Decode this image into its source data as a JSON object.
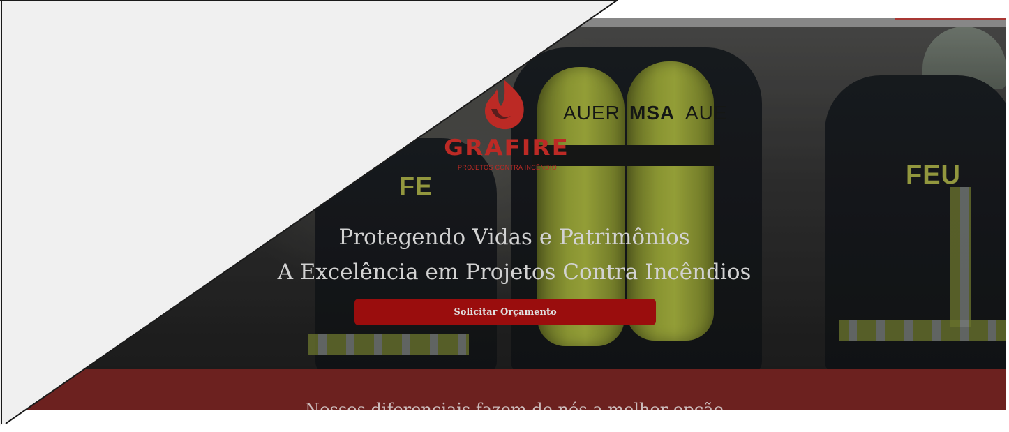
{
  "brand": {
    "name": "GRAFIRE",
    "tagline": "PROJETOS CONTRA INCÊNDIO",
    "color": "#d6302b"
  },
  "hero": {
    "headline_line1": "Protegendo Vidas e Patrimônios",
    "headline_line2": "A Excelência em Projetos Contra Incêndios",
    "tank_text_left": "AUER",
    "tank_text_mid": "MSA",
    "tank_text_right": "AUE",
    "jacket_text_left": "FE",
    "jacket_text_right": "FEU"
  },
  "cta": {
    "label": "Solicitar Orçamento",
    "color": "#b00f0f"
  },
  "band": {
    "text": "Nossos diferenciais fazem de nós a melhor opção",
    "color": "#7c2624"
  },
  "icons": {
    "logo": "flame-icon"
  }
}
